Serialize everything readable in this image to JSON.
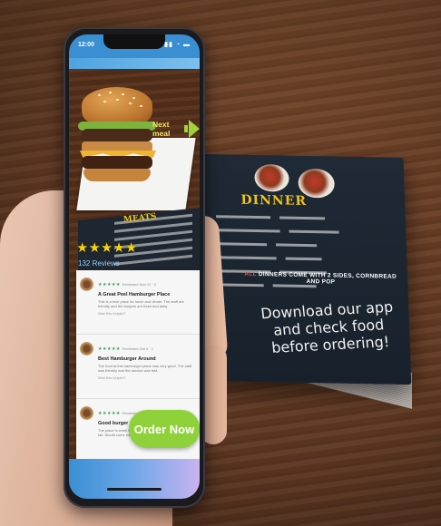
{
  "status": {
    "time": "12:00",
    "icons": "▮▮ ◔ ▬"
  },
  "hero": {
    "next_meal_label": "Next meal"
  },
  "menu_preview": {
    "section_title": "MEATS"
  },
  "rating": {
    "stars": 5,
    "star_glyph": "★",
    "reviews_label": "132 Reviews"
  },
  "reviews": [
    {
      "stars": "★★★★★",
      "meta": "Reviewed Nov 12 · 2",
      "title": "A Great Peel Hamburger Place",
      "body": "This is a nice place for lunch and dinner. The staff are friendly and the burgers are fresh and tasty.",
      "helpful": "Was this helpful?"
    },
    {
      "stars": "★★★★★",
      "meta": "Reviewed Oct 3 · 1",
      "title": "Best Hamburger Around",
      "body": "The food at this hamburger place was very good. The staff was friendly and the service was fast.",
      "helpful": "Was this helpful?"
    },
    {
      "stars": "★★★★★",
      "meta": "Reviewed Sep 21 · 4",
      "title": "Good burger - good price",
      "body": "The place is small but the burgers are big and the price is fair. Would come back again.",
      "helpful": "Was this helpful?"
    }
  ],
  "order_button": {
    "label": "Order Now"
  },
  "booklet": {
    "title": "DINNER",
    "note_prefix": "ALL",
    "note_rest": " DINNERS COME WITH 2 SIDES, CORNBREAD AND POP",
    "download_text": "Download our app and check food before ordering!"
  },
  "colors": {
    "accent_green": "#8fd13a",
    "star_yellow": "#f5d20c",
    "menu_yellow": "#f1c40f",
    "brand_blue": "#3a8fd3"
  }
}
